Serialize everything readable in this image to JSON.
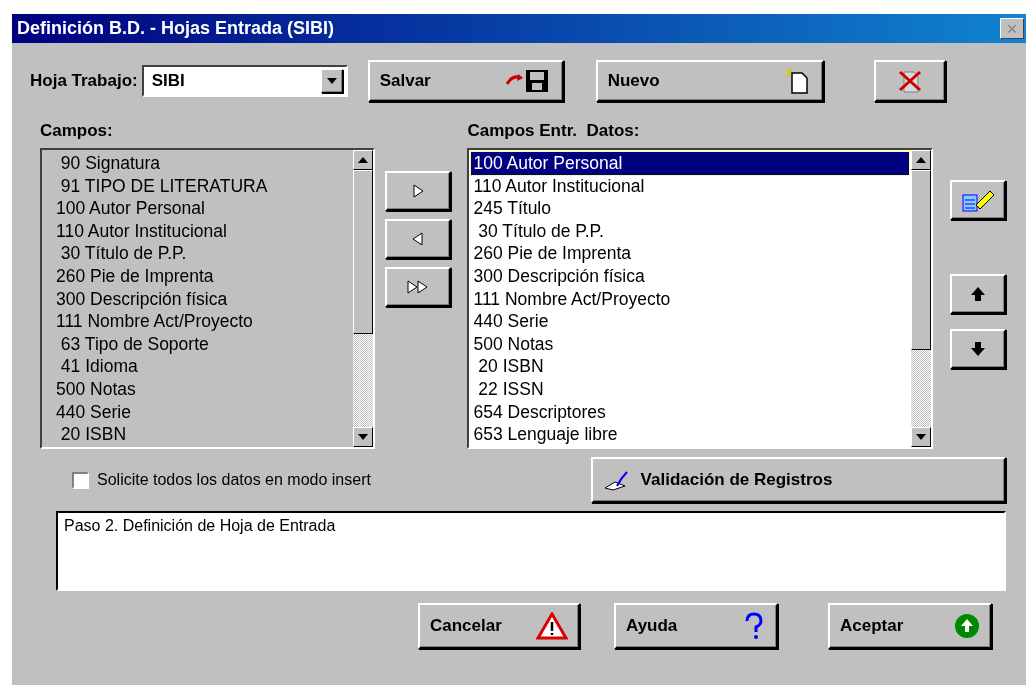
{
  "window": {
    "title": "Definición B.D. - Hojas Entrada (SIBI)",
    "close": "×"
  },
  "worksheet": {
    "label": "Hoja Trabajo:",
    "value": "SIBI"
  },
  "top_buttons": [
    {
      "kind": "save",
      "label": "Salvar"
    },
    {
      "kind": "new",
      "label": "Nuevo"
    },
    {
      "kind": "delete"
    }
  ],
  "fields": {
    "label": "Campos:",
    "items": [
      {
        "text": " 90 Signatura"
      },
      {
        "text": " 91 TIPO DE LITERATURA"
      },
      {
        "text": "100 Autor Personal"
      },
      {
        "text": "110 Autor Institucional"
      },
      {
        "text": " 30 Título de P.P."
      },
      {
        "text": "260 Pie de Imprenta"
      },
      {
        "text": "300 Descripción física"
      },
      {
        "text": "111 Nombre Act/Proyecto"
      },
      {
        "text": " 63 Tipo de Soporte"
      },
      {
        "text": " 41 Idioma"
      },
      {
        "text": "500 Notas"
      },
      {
        "text": "440 Serie"
      },
      {
        "text": " 20 ISBN"
      }
    ]
  },
  "move_buttons": [
    {
      "kind": "add"
    },
    {
      "kind": "remove"
    },
    {
      "kind": "add_all"
    }
  ],
  "entry_fields": {
    "label": "Campos Entr.  Datos:",
    "items": [
      {
        "text": "100 Autor Personal",
        "selected": true
      },
      {
        "text": "110 Autor Institucional",
        "selected": false
      },
      {
        "text": "245 Título",
        "selected": false
      },
      {
        "text": " 30 Título de P.P.",
        "selected": false
      },
      {
        "text": "260 Pie de Imprenta",
        "selected": false
      },
      {
        "text": "300 Descripción física",
        "selected": false
      },
      {
        "text": "111 Nombre Act/Proyecto",
        "selected": false
      },
      {
        "text": "440 Serie",
        "selected": false
      },
      {
        "text": "500 Notas",
        "selected": false
      },
      {
        "text": " 20 ISBN",
        "selected": false
      },
      {
        "text": " 22 ISSN",
        "selected": false
      },
      {
        "text": "654 Descriptores",
        "selected": false
      },
      {
        "text": "653 Lenguaje libre",
        "selected": false
      }
    ]
  },
  "side_buttons": [
    {
      "kind": "edit"
    },
    {
      "kind": "up"
    },
    {
      "kind": "down"
    }
  ],
  "insert_mode": {
    "label": "Solicite todos los datos en modo insert",
    "checked": false
  },
  "validation_button": {
    "label": "Validación de Registros"
  },
  "message": "Paso 2. Definición de Hoja de Entrada",
  "bottom_buttons": [
    {
      "kind": "cancel",
      "label": "Cancelar"
    },
    {
      "kind": "help",
      "label": "Ayuda"
    },
    {
      "kind": "ok",
      "label": "Aceptar"
    }
  ]
}
